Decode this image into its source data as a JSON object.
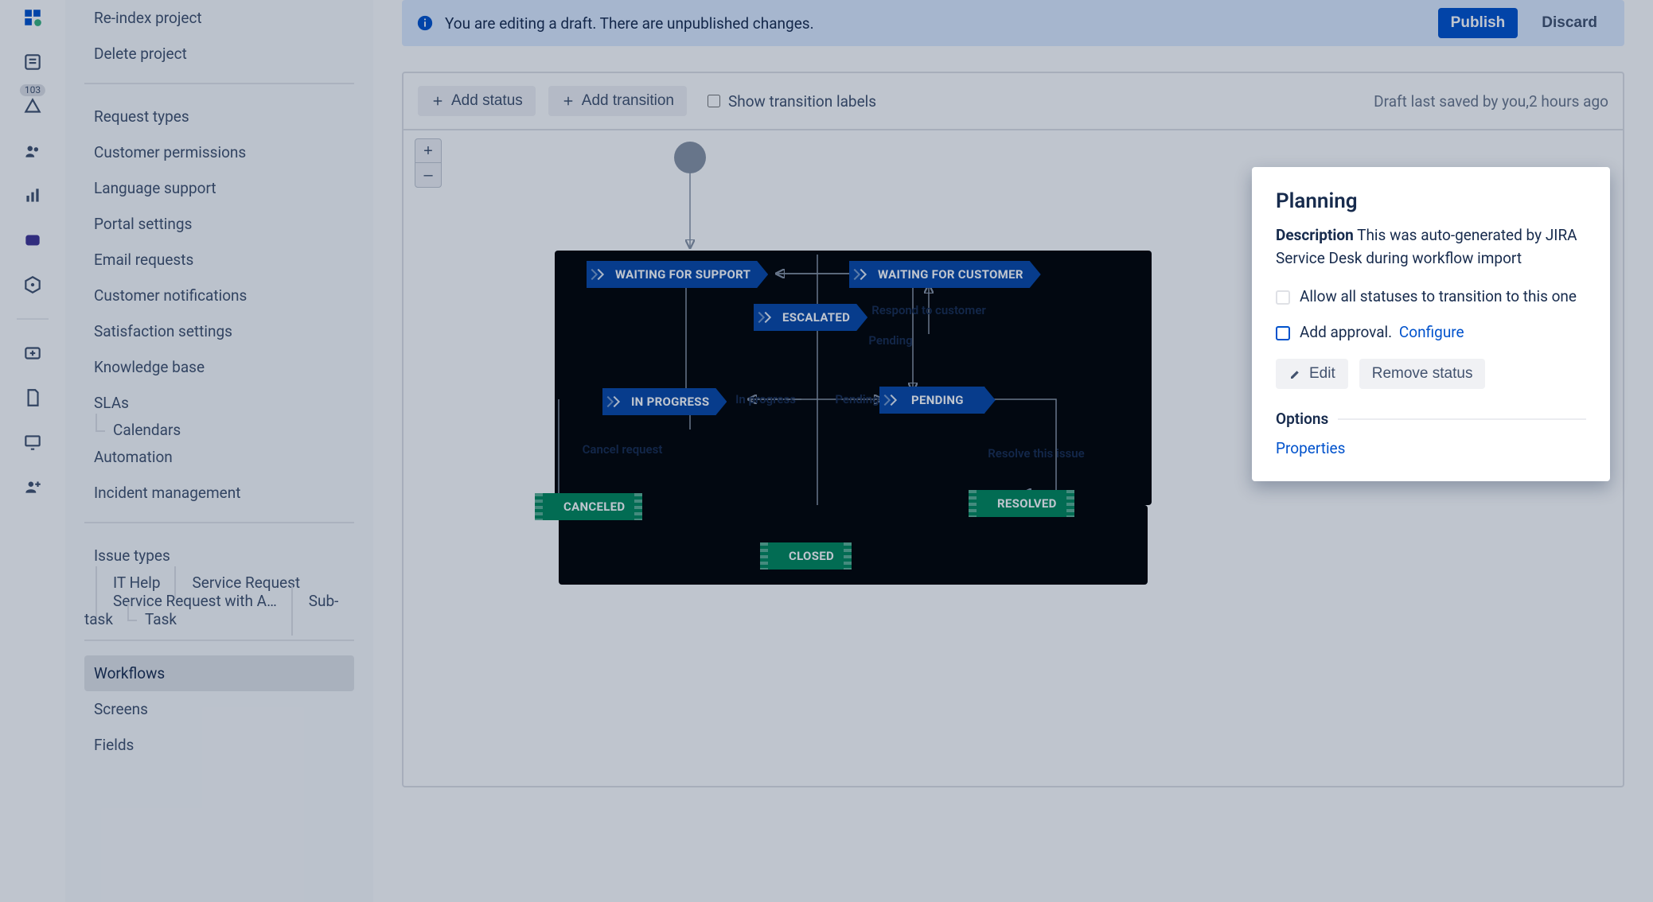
{
  "rail": {
    "badge": "103"
  },
  "sidebar": {
    "items": [
      "Re-index project",
      "Delete project",
      "Request types",
      "Customer permissions",
      "Language support",
      "Portal settings",
      "Email requests",
      "Customer notifications",
      "Satisfaction settings",
      "Knowledge base",
      "SLAs",
      "Calendars",
      "Automation",
      "Incident management"
    ],
    "issue_types_heading": "Issue types",
    "issue_types": [
      "IT Help",
      "Service Request",
      "Service Request with A…",
      "Sub-task",
      "Task"
    ],
    "bottom": [
      "Workflows",
      "Screens",
      "Fields"
    ]
  },
  "banner": {
    "text": "You are editing a draft. There are unpublished changes.",
    "publish": "Publish",
    "discard": "Discard"
  },
  "toolbar": {
    "add_status": "Add status",
    "add_transition": "Add transition",
    "show_labels": "Show transition labels",
    "draft_saved_prefix": "Draft last saved by you,",
    "draft_saved_time": "2 hours ago"
  },
  "zoom": {
    "in": "+",
    "out": "–"
  },
  "statuses": {
    "waiting_support": "WAITING FOR SUPPORT",
    "waiting_customer": "WAITING FOR CUSTOMER",
    "escalated": "ESCALATED",
    "in_progress": "IN PROGRESS",
    "pending": "PENDING",
    "canceled": "CANCELED",
    "resolved": "RESOLVED",
    "closed": "CLOSED"
  },
  "transitions": {
    "respond": "Respond to customer",
    "pending1": "Pending",
    "in_progress": "In progress",
    "pending2": "Pending",
    "cancel": "Cancel request",
    "resolve": "Resolve this issue"
  },
  "panel": {
    "title": "Planning",
    "desc_label": "Description",
    "desc_text": "This was auto-generated by JIRA Service Desk during workflow import",
    "allow_all": "Allow all statuses to transition to this one",
    "add_approval": "Add approval.",
    "configure": "Configure",
    "edit": "Edit",
    "remove": "Remove status",
    "options": "Options",
    "properties": "Properties"
  }
}
